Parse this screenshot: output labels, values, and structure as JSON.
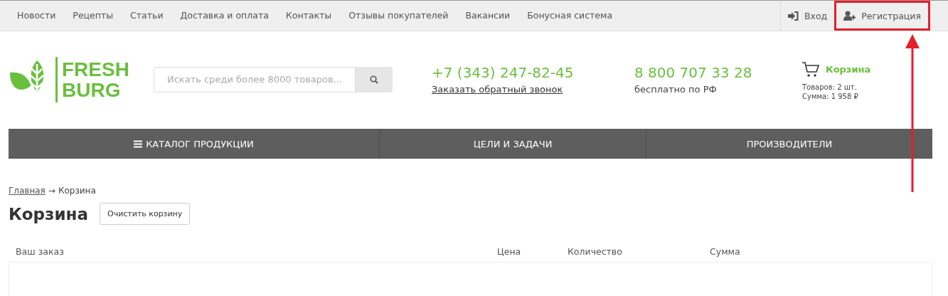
{
  "top_nav": {
    "links": [
      "Новости",
      "Рецепты",
      "Статьи",
      "Доставка и оплата",
      "Контакты",
      "Отзывы покупателей",
      "Вакансии",
      "Бонусная система"
    ],
    "account": [
      {
        "kind": "login",
        "label": "Вход",
        "highlighted": false
      },
      {
        "kind": "register",
        "label": "Регистрация",
        "highlighted": true
      }
    ]
  },
  "logo": {
    "line_1": "FRESH",
    "line_2": "BURG"
  },
  "search": {
    "placeholder": "Искать среди более 8000 товаров..."
  },
  "phone_1": {
    "number": "+7 (343) 247-82-45",
    "link": "Заказать обратный звонок"
  },
  "phone_2": {
    "number": "8 800 707 33 28",
    "note": "бесплатно по РФ"
  },
  "cart": {
    "title": "Корзина",
    "items": "Товаров: 2 шт.",
    "total": "Сумма: 1 958 ₽"
  },
  "main_menu": [
    {
      "label": "КАТАЛОГ ПРОДУКЦИИ",
      "kind": "catalog"
    },
    {
      "label": "ЦЕЛИ И ЗАДАЧИ",
      "kind": "plain"
    },
    {
      "label": "ПРОИЗВОДИТЕЛИ",
      "kind": "plain"
    }
  ],
  "breadcrumb": {
    "link": "Главная",
    "separator": "→",
    "current": "Корзина"
  },
  "page_title": "Корзина",
  "clear_button": "Очистить корзину",
  "table": {
    "columns": [
      "Ваш заказ",
      "Цена",
      "Количество",
      "Сумма"
    ]
  }
}
